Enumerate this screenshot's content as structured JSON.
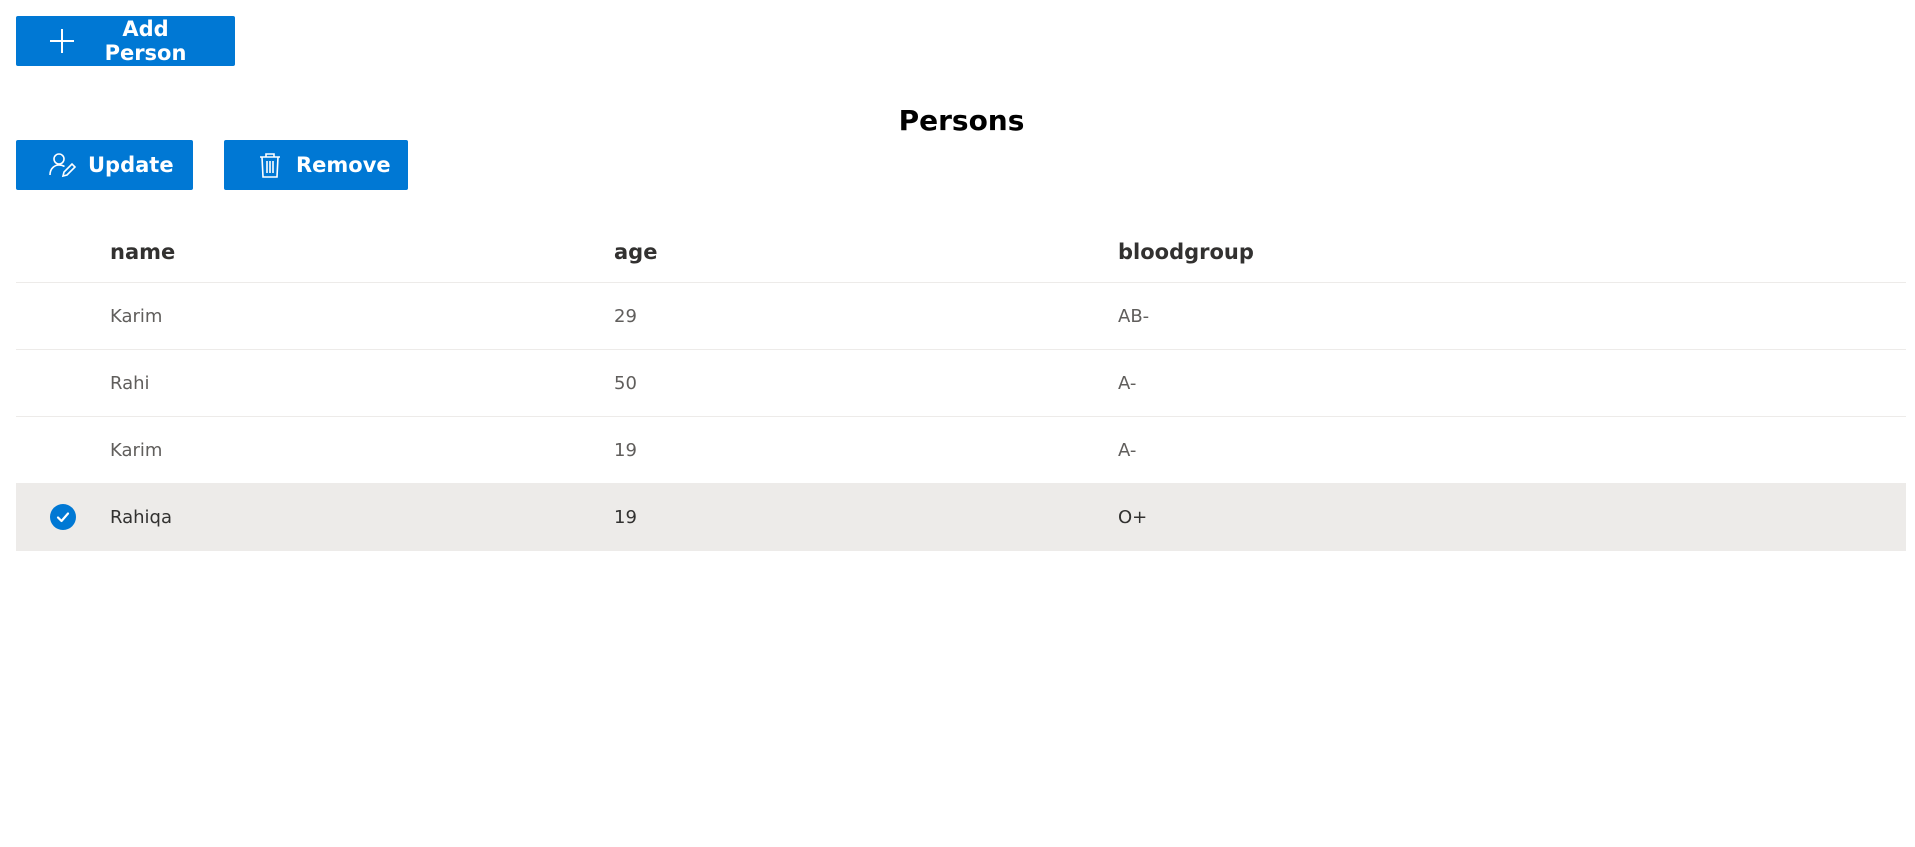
{
  "toolbar": {
    "add_label": "Add Person",
    "update_label": "Update",
    "remove_label": "Remove"
  },
  "page": {
    "title": "Persons"
  },
  "table": {
    "columns": [
      "name",
      "age",
      "bloodgroup"
    ],
    "rows": [
      {
        "name": "Karim",
        "age": "29",
        "bloodgroup": "AB-",
        "selected": false
      },
      {
        "name": "Rahi",
        "age": "50",
        "bloodgroup": "A-",
        "selected": false
      },
      {
        "name": "Karim",
        "age": "19",
        "bloodgroup": "A-",
        "selected": false
      },
      {
        "name": "Rahiqa",
        "age": "19",
        "bloodgroup": "O+",
        "selected": true
      }
    ]
  },
  "icons": {
    "add": "plus-icon",
    "update": "edit-person-icon",
    "remove": "trash-icon",
    "selected": "checkmark-icon"
  },
  "colors": {
    "accent": "#0078d4",
    "selected_row": "#edebe9"
  }
}
